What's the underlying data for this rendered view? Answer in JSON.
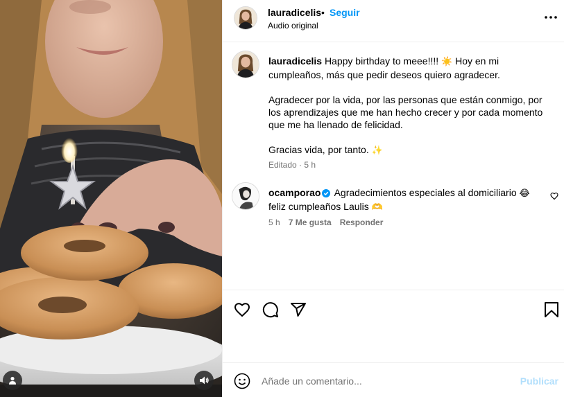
{
  "post": {
    "username": "lauradicelis",
    "dot": "•",
    "follow_label": "Seguir",
    "audio_label": "Audio original"
  },
  "caption": {
    "username": "lauradicelis",
    "line1": "Happy birthday to meee!!!! ",
    "emoji_sun": "☀️",
    "line1_rest": "  Hoy en mi cumpleaños, más que pedir deseos quiero agradecer.",
    "para2": "Agradecer por la vida, por las personas que están conmigo, por los aprendizajes que me han hecho crecer y por cada momento que me ha llenado de felicidad.",
    "para3": "Gracias vida, por tanto. ",
    "emoji_sparkles": "✨",
    "edited": "Editado",
    "dot": "·",
    "time": "5 h"
  },
  "comment": {
    "username": "ocamporao",
    "text1": " Agradecimientos especiales al domiciliario ",
    "emoji_laugh": "😂",
    "text2": "feliz cumpleaños Laulis ",
    "emoji_heart_hands": "🫶",
    "time": "5 h",
    "likes": "7 Me gusta",
    "reply_label": "Responder"
  },
  "composer": {
    "placeholder": "Añade un comentario...",
    "publish_label": "Publicar"
  },
  "icons": {
    "more": "more-options-icon",
    "like": "heart-icon",
    "comment": "comment-icon",
    "share": "share-icon",
    "save": "bookmark-icon",
    "emoji": "emoji-icon",
    "user_tag": "user-tag-icon",
    "audio": "volume-icon"
  },
  "colors": {
    "link": "#0095f6",
    "muted": "#737373",
    "publish_disabled": "#b2dffc",
    "divider": "#efefef"
  }
}
